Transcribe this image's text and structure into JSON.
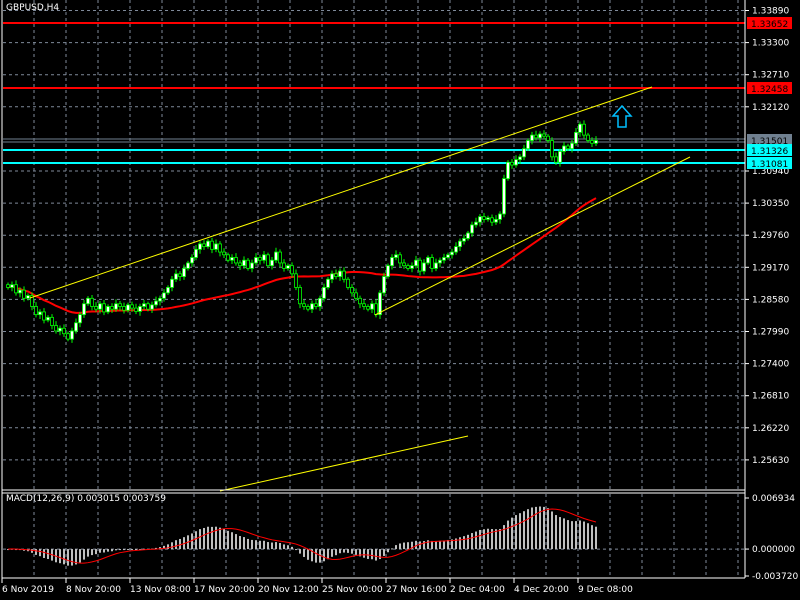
{
  "window": {
    "symbol_title": "GBPUSD,H4"
  },
  "colors": {
    "background": "#000000",
    "candle_outline": "#00ff00",
    "bull_body": "#ffffff",
    "bear_body": "#000000",
    "ma": "#ff0000",
    "trendline": "#ffff00",
    "resistance": "#ff0000",
    "support": "#00ffff",
    "bid": "#708090",
    "grid": "#7f8a9a"
  },
  "price_axis": {
    "ticks": [
      "1.33890",
      "1.33300",
      "1.32710",
      "1.32120",
      "1.30940",
      "1.30350",
      "1.29760",
      "1.29170",
      "1.28580",
      "1.27990",
      "1.27400",
      "1.26810",
      "1.26220",
      "1.25630"
    ],
    "levels": [
      {
        "name": "resistance-level-1",
        "price": "1.33652",
        "color": "#ff0000",
        "label_text_color": "#000000"
      },
      {
        "name": "resistance-level-2",
        "price": "1.32458",
        "color": "#ff0000",
        "label_text_color": "#000000"
      },
      {
        "name": "bid-price",
        "price": "1.31501",
        "color": "#708090",
        "label_text_color": "#000000"
      },
      {
        "name": "support-level-1",
        "price": "1.31326",
        "color": "#00ffff",
        "label_text_color": "#000000"
      },
      {
        "name": "support-level-2",
        "price": "1.31081",
        "color": "#00ffff",
        "label_text_color": "#000000"
      }
    ]
  },
  "time_axis": {
    "labels": [
      "6 Nov 2019",
      "8 Nov 20:00",
      "13 Nov 08:00",
      "17 Nov 20:00",
      "20 Nov 12:00",
      "25 Nov 00:00",
      "27 Nov 16:00",
      "2 Dec 04:00",
      "4 Dec 20:00",
      "9 Dec 08:00"
    ]
  },
  "macd": {
    "title": "MACD(12,26,9) 0.003015 0.003759",
    "ticks": [
      "0.006934",
      "0.000000",
      "-0.003720"
    ],
    "max": 0.006934,
    "min": -0.00372
  },
  "arrow": {
    "icon": "up-arrow-icon",
    "color": "#00bfff"
  },
  "chart_data": {
    "type": "candlestick",
    "title": "GBPUSD,H4",
    "ylim": [
      1.254,
      1.34
    ],
    "closes": [
      1.288,
      1.2885,
      1.287,
      1.2875,
      1.286,
      1.2865,
      1.2845,
      1.283,
      1.2835,
      1.282,
      1.2825,
      1.281,
      1.28,
      1.2805,
      1.2795,
      1.2785,
      1.28,
      1.2815,
      1.283,
      1.285,
      1.286,
      1.2845,
      1.284,
      1.285,
      1.2835,
      1.2845,
      1.284,
      1.285,
      1.2845,
      1.2838,
      1.2848,
      1.2842,
      1.2836,
      1.2845,
      1.285,
      1.284,
      1.2848,
      1.2855,
      1.286,
      1.287,
      1.288,
      1.2895,
      1.2905,
      1.29,
      1.2915,
      1.2925,
      1.2935,
      1.295,
      1.296,
      1.2955,
      1.2965,
      1.295,
      1.296,
      1.2945,
      1.294,
      1.293,
      1.2935,
      1.2925,
      1.292,
      1.293,
      1.2915,
      1.2925,
      1.2935,
      1.293,
      1.294,
      1.292,
      1.293,
      1.2945,
      1.2925,
      1.2915,
      1.292,
      1.2905,
      1.288,
      1.285,
      1.2845,
      1.284,
      1.285,
      1.2845,
      1.286,
      1.288,
      1.2895,
      1.2905,
      1.29,
      1.291,
      1.2895,
      1.288,
      1.287,
      1.286,
      1.285,
      1.2845,
      1.284,
      1.285,
      1.283,
      1.287,
      1.29,
      1.292,
      1.2935,
      1.294,
      1.2925,
      1.292,
      1.2915,
      1.292,
      1.293,
      1.291,
      1.2925,
      1.2935,
      1.2915,
      1.2925,
      1.293,
      1.2935,
      1.294,
      1.2945,
      1.2955,
      1.2965,
      1.297,
      1.298,
      1.2995,
      1.3,
      1.301,
      1.3005,
      1.3008,
      1.3,
      1.3005,
      1.3015,
      1.308,
      1.311,
      1.3105,
      1.3115,
      1.312,
      1.3135,
      1.315,
      1.316,
      1.3155,
      1.3162,
      1.3158,
      1.315,
      1.312,
      1.311,
      1.313,
      1.314,
      1.3135,
      1.3145,
      1.3165,
      1.318,
      1.316,
      1.315,
      1.3145,
      1.315
    ]
  }
}
